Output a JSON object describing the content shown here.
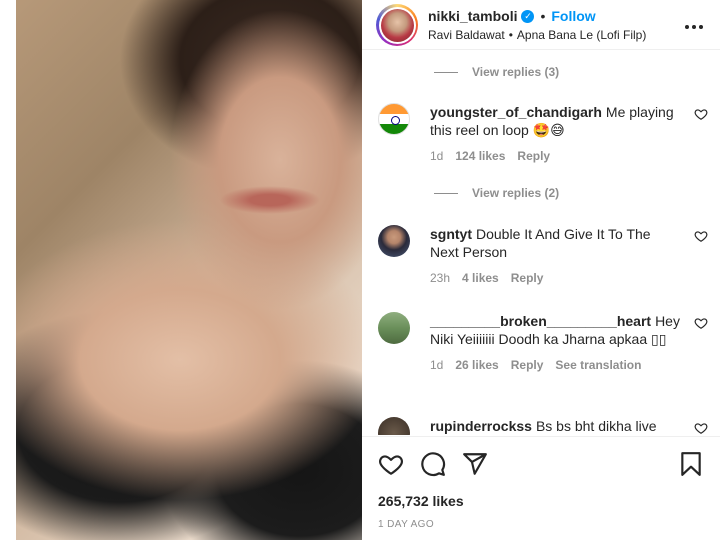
{
  "header": {
    "username": "nikki_tamboli",
    "verified_icon": "verified-badge-icon",
    "separator": "•",
    "follow_label": "Follow",
    "audio_artist": "Ravi Baldawat",
    "audio_separator": "•",
    "audio_track": "Apna Bana Le (Lofi Filp)",
    "more_icon": "more-options-icon"
  },
  "comments": {
    "view_replies_1": "View replies (3)",
    "view_replies_2": "View replies (2)",
    "items": [
      {
        "username": "youngster_of_chandigarh",
        "text": "Me playing this reel on loop 🤩😅",
        "time": "1d",
        "likes": "124 likes",
        "reply_label": "Reply",
        "avatar": "india-flag-avatar"
      },
      {
        "username": "sgntyt",
        "text": "Double It And Give It To The Next Person",
        "time": "23h",
        "likes": "4 likes",
        "reply_label": "Reply",
        "avatar": "man-avatar"
      },
      {
        "username": "_________broken_________heart",
        "text": "Hey Niki Yeiiiiiii Doodh ka Jharna apkaa ▯▯",
        "time": "1d",
        "likes": "26 likes",
        "reply_label": "Reply",
        "translation_label": "See translation",
        "avatar": "landscape-avatar"
      },
      {
        "username": "rupinderrockss",
        "text": "Bs bs bht dikha live",
        "avatar": "dark-avatar"
      }
    ]
  },
  "actions": {
    "icons": [
      "heart-icon",
      "comment-icon",
      "share-icon",
      "bookmark-icon"
    ],
    "likes": "265,732 likes",
    "date": "1 DAY AGO"
  },
  "colors": {
    "accent": "#0095f6",
    "text": "#262626",
    "muted": "#8e8e8e",
    "divider": "#efefef"
  }
}
